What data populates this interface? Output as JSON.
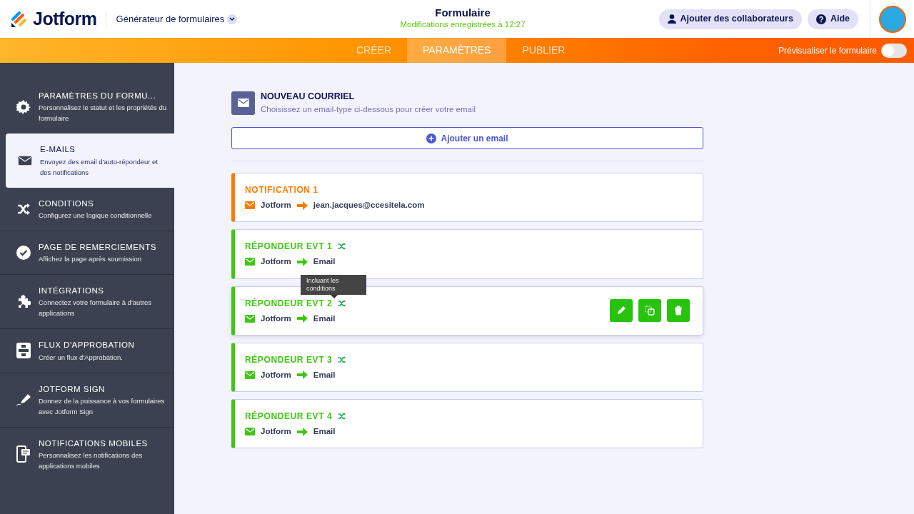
{
  "header": {
    "logo": "Jotform",
    "builder_menu": "Générateur de formulaires",
    "title": "Formulaire",
    "save_status": "Modifications enregistrées à 12:27",
    "buttons": [
      {
        "kind": "user",
        "label": "Ajouter des collaborateurs"
      },
      {
        "kind": "help",
        "label": "Aide"
      }
    ]
  },
  "tabs": [
    {
      "label": "CRÉER",
      "selected": false
    },
    {
      "label": "PARAMÈTRES",
      "selected": true
    },
    {
      "label": "PUBLIER",
      "selected": false
    }
  ],
  "preview": {
    "label": "Prévisualiser le formulaire",
    "on": false
  },
  "sidebar": {
    "items": [
      {
        "kind": "gear",
        "title": "PARAMÈTRES DU FORMU...",
        "description": "Personnalisez le statut et les propriétés du formulaire",
        "selected": false
      },
      {
        "kind": "mail",
        "title": "E-MAILS",
        "description": "Envoyez des email d'auto-répondeur et des notifications",
        "selected": true
      },
      {
        "kind": "shuffle",
        "title": "CONDITIONS",
        "description": "Configurez une logique conditionnelle",
        "selected": false
      },
      {
        "kind": "check",
        "title": "PAGE DE REMERCIEMENTS",
        "description": "Affichez la page après soumission",
        "selected": false
      },
      {
        "kind": "puzzle",
        "title": "INTÉGRATIONS",
        "description": "Connectez votre formulaire à d'autres applications",
        "selected": false
      },
      {
        "kind": "flow",
        "title": "FLUX D'APPROBATION",
        "description": "Créer un flux d'Approbation.",
        "selected": false
      },
      {
        "kind": "pen",
        "title": "JOTFORM SIGN",
        "description": "Donnez de la puissance à vos formulaires avec Jotform Sign",
        "selected": false
      },
      {
        "kind": "phone",
        "title": "NOTIFICATIONS MOBILES",
        "description": "Personnalisez les notifications des applications mobiles",
        "selected": false
      }
    ]
  },
  "new_email": {
    "title": "NOUVEAU COURRIEL",
    "subtitle": "Choisissez un email-type ci-dessous pour créer votre email",
    "add_button": "Ajouter un email"
  },
  "emails": [
    {
      "title": "NOTIFICATION 1",
      "color": "#ff7a00",
      "condition": false,
      "sender": "Jotform",
      "recipient": "jean.jacques@ccesitela.com",
      "hovered": false
    },
    {
      "title": "RÉPONDEUR EVT 1",
      "color": "#3fc813",
      "condition": true,
      "sender": "Jotform",
      "recipient": "Email",
      "hovered": false
    },
    {
      "title": "RÉPONDEUR EVT 2",
      "color": "#3fc813",
      "condition": true,
      "sender": "Jotform",
      "recipient": "Email",
      "hovered": true,
      "tooltip": "Incluant les conditions"
    },
    {
      "title": "RÉPONDEUR EVT 3",
      "color": "#3fc813",
      "condition": true,
      "sender": "Jotform",
      "recipient": "Email",
      "hovered": false
    },
    {
      "title": "RÉPONDEUR EVT 4",
      "color": "#3fc813",
      "condition": true,
      "sender": "Jotform",
      "recipient": "Email",
      "hovered": false
    }
  ]
}
